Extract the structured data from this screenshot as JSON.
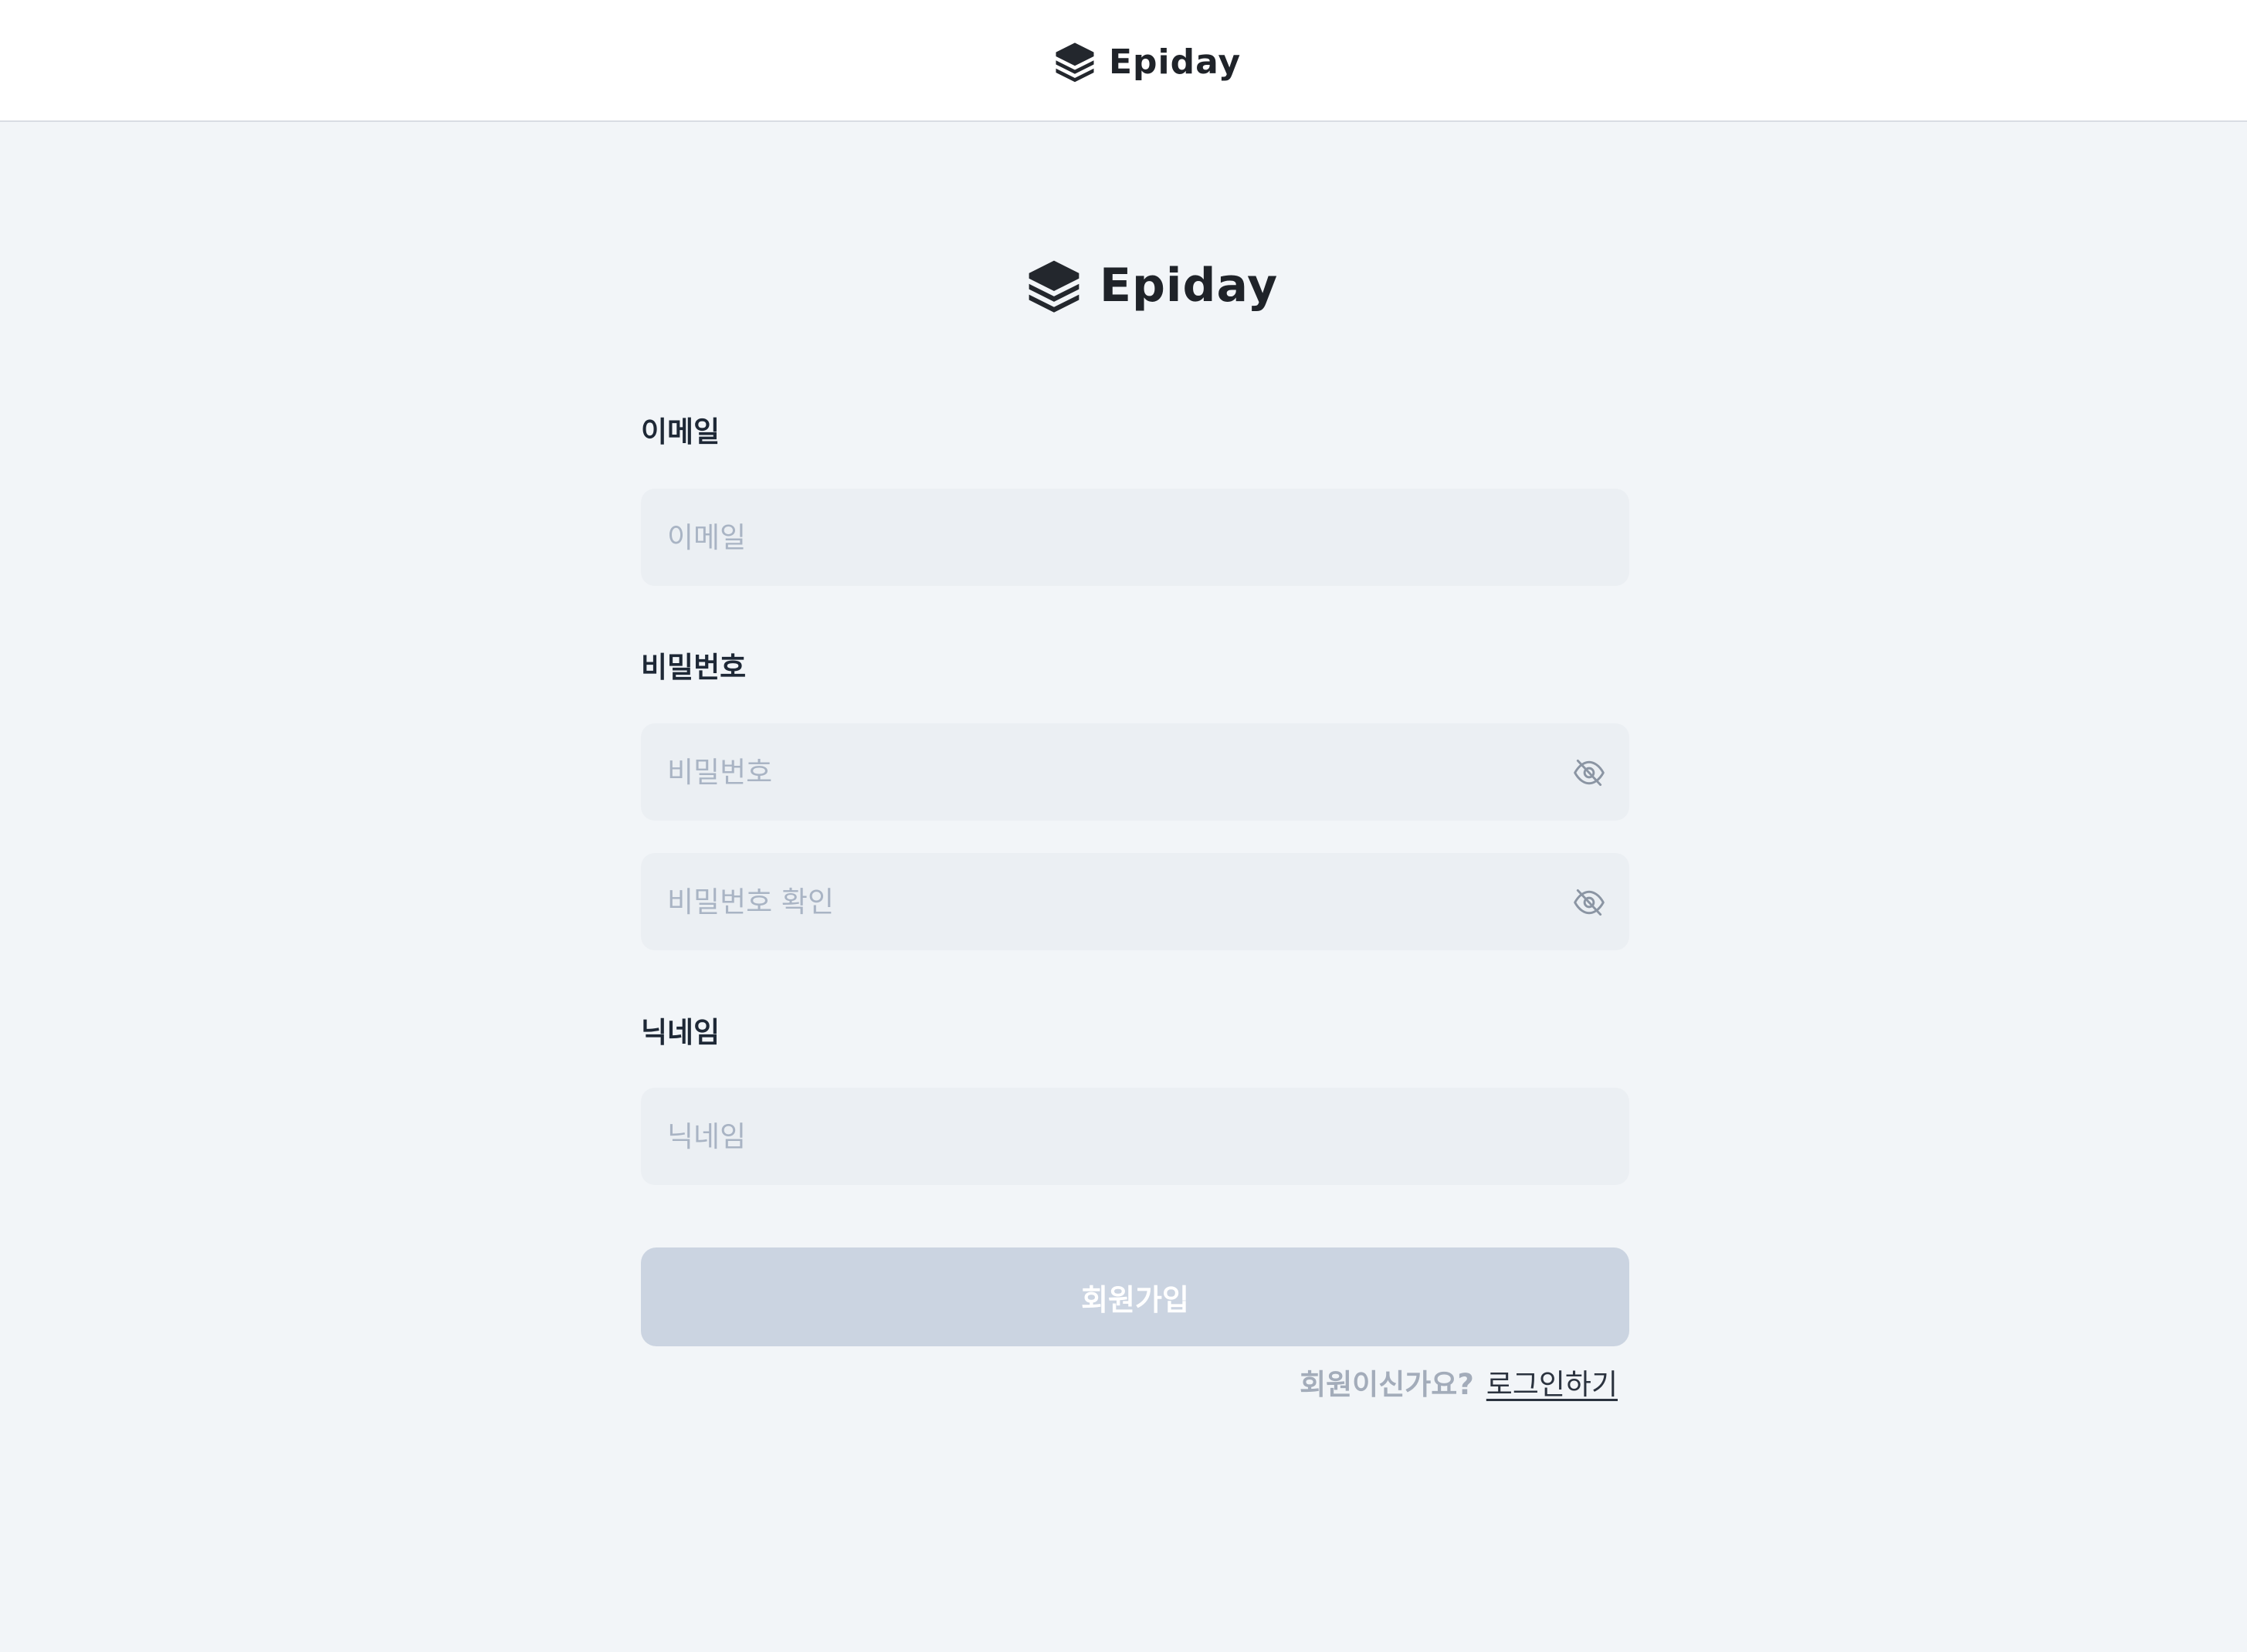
{
  "app": {
    "brand": "Epiday"
  },
  "header": {
    "logo_icon": "stacked-layers-icon",
    "brand": "Epiday"
  },
  "form": {
    "logo_icon": "stacked-layers-icon",
    "brand": "Epiday",
    "email": {
      "label": "이메일",
      "placeholder": "이메일",
      "value": ""
    },
    "password": {
      "label": "비밀번호",
      "placeholder": "비밀번호",
      "confirm_placeholder": "비밀번호 확인",
      "value": "",
      "confirm_value": "",
      "toggle_icon": "eye-off-icon"
    },
    "nickname": {
      "label": "닉네임",
      "placeholder": "닉네임",
      "value": ""
    },
    "submit_label": "회원가입",
    "login_prompt": "회원이신가요?",
    "login_link": "로그인하기"
  },
  "colors": {
    "page_background": "#f2f5f8",
    "input_background": "#ebeff3",
    "submit_disabled": "#cbd4e1",
    "placeholder": "#a9b4c4",
    "text_dark": "#1e2836"
  }
}
